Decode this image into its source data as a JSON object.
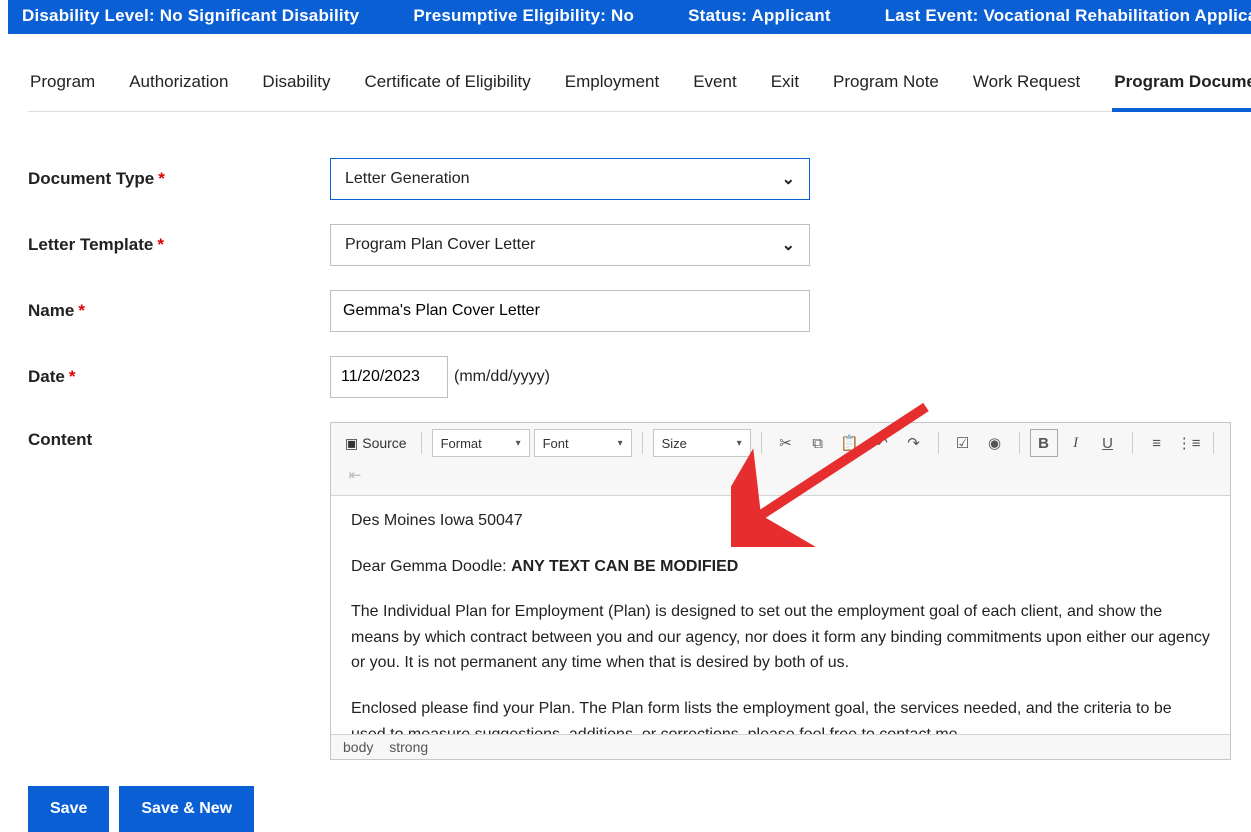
{
  "statusBar": {
    "disability": "Disability Level: No Significant Disability",
    "presumptive": "Presumptive Eligibility: No",
    "status": "Status: Applicant",
    "lastEvent": "Last Event: Vocational Rehabilitation Application Submitted"
  },
  "tabs": {
    "program": "Program",
    "authorization": "Authorization",
    "disability": "Disability",
    "cert": "Certificate of Eligibility",
    "employment": "Employment",
    "event": "Event",
    "exit": "Exit",
    "programNote": "Program Note",
    "workRequest": "Work Request",
    "programDocument": "Program Document"
  },
  "form": {
    "docTypeLabel": "Document Type",
    "docTypeValue": "Letter Generation",
    "letterTemplateLabel": "Letter Template",
    "letterTemplateValue": "Program Plan Cover Letter",
    "nameLabel": "Name",
    "nameValue": "Gemma's Plan Cover Letter",
    "dateLabel": "Date",
    "dateValue": "11/20/2023",
    "dateHint": "(mm/dd/yyyy)",
    "contentLabel": "Content"
  },
  "toolbar": {
    "source": "Source",
    "format": "Format",
    "font": "Font",
    "size": "Size"
  },
  "editor": {
    "line1": "Des Moines Iowa 50047",
    "salutationPrefix": "Dear Gemma Doodle: ",
    "salutationBold": "ANY TEXT CAN BE MODIFIED",
    "para2": "The Individual Plan for Employment (Plan) is designed to set out the employment goal of each client, and show the means by which contract between you and our agency, nor does it form any binding commitments upon either our agency or you. It is not permanent any time when that is desired by both of us.",
    "para3": "Enclosed please find your Plan. The Plan form lists the employment goal, the services needed, and the criteria to be used to measure suggestions, additions, or corrections, please feel free to contact me.",
    "pathBody": "body",
    "pathStrong": "strong"
  },
  "buttons": {
    "save": "Save",
    "saveNew": "Save & New"
  }
}
